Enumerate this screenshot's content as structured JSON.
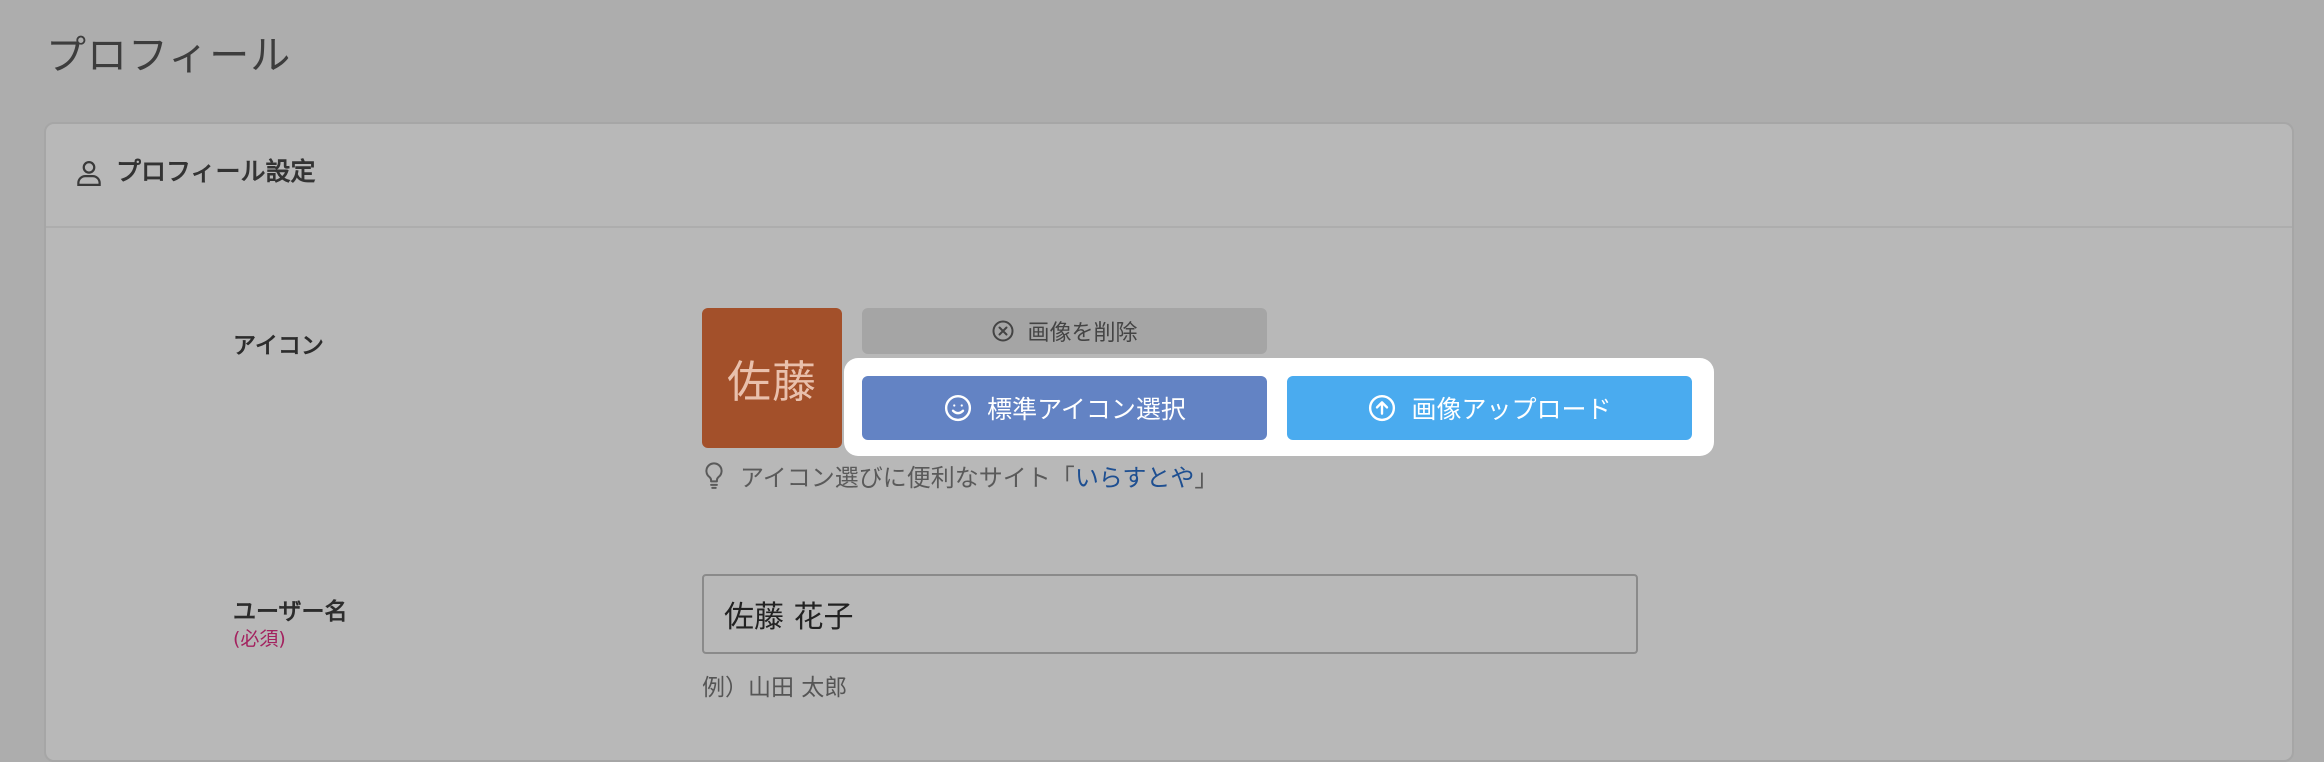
{
  "page": {
    "title": "プロフィール"
  },
  "card": {
    "header_title": "プロフィール設定"
  },
  "icon_field": {
    "label": "アイコン",
    "avatar_text": "佐藤",
    "delete_button": "画像を削除",
    "standard_icon_button": "標準アイコン選択",
    "upload_button": "画像アップロード",
    "hint_prefix": "アイコン選びに便利なサイト「",
    "hint_link": "いらすとや",
    "hint_suffix": "」"
  },
  "username_field": {
    "label": "ユーザー名",
    "required": "(必須)",
    "value": "佐藤 花子",
    "example": "例）山田 太郎"
  },
  "icons": {
    "header": "user-icon",
    "delete": "circle-x-icon",
    "standard": "smiley-icon",
    "upload": "circle-arrow-up-icon",
    "hint": "lightbulb-icon"
  },
  "colors": {
    "avatar_bg": "#a3502a",
    "standard_button": "#6383c4",
    "upload_button": "#4aabef",
    "required": "#a3225f",
    "link": "#1e4f91"
  }
}
